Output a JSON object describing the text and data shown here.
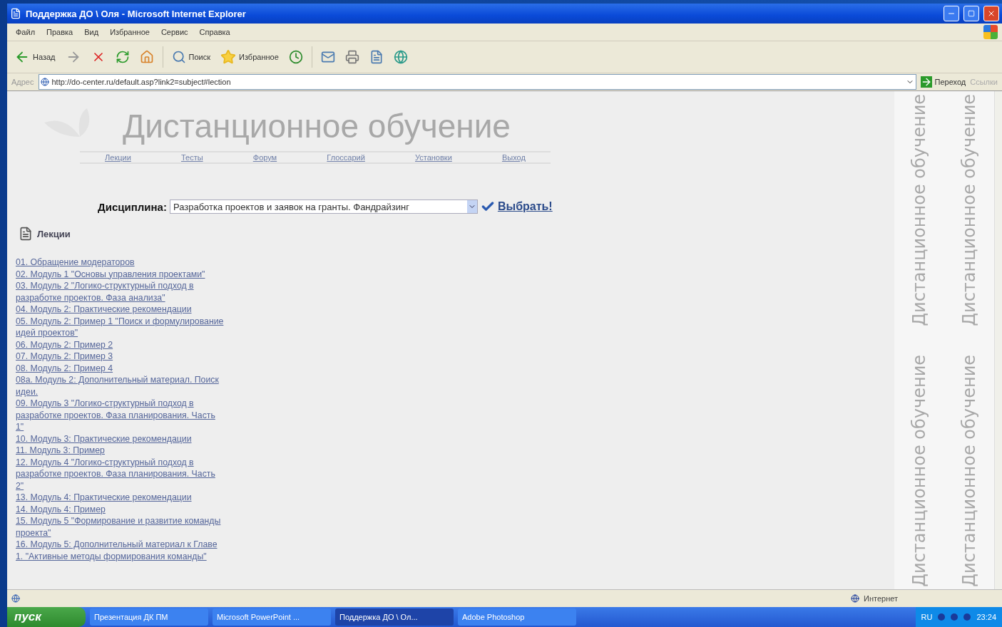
{
  "window": {
    "title": "Поддержка ДО \\ Оля - Microsoft Internet Explorer"
  },
  "menu": [
    "Файл",
    "Правка",
    "Вид",
    "Избранное",
    "Сервис",
    "Справка"
  ],
  "toolbar": {
    "back": "Назад",
    "search": "Поиск",
    "favorites": "Избранное"
  },
  "address": {
    "label": "Адрес",
    "value": "http://do-center.ru/default.asp?link2=subject#lection",
    "go": "Переход",
    "links": "Ссылки"
  },
  "page": {
    "logo": "Дистанционное обучение",
    "nav": [
      "Лекции",
      "Тесты",
      "Форум",
      "Глоссарий",
      "Установки",
      "Выход"
    ],
    "discipline_label": "Дисциплина:",
    "discipline_value": "Разработка проектов и заявок на гранты. Фандрайзинг",
    "select_button": "Выбрать!",
    "section_title": "Лекции",
    "lectures": [
      "01. Обращение модераторов",
      "02. Модуль 1 \"Основы управления проектами\"",
      "03. Модуль 2 \"Логико-структурный подход в разработке проектов. Фаза анализа\"",
      "04. Модуль 2: Практические рекомендации",
      "05. Модуль 2: Пример 1 \"Поиск и формулирование идей проектов\"",
      "06. Модуль 2: Пример 2",
      "07. Модуль 2: Пример 3",
      "08. Модуль 2: Пример 4",
      "08а. Модуль 2: Дополнительный материал. Поиск идеи.",
      "09. Модуль 3 \"Логико-структурный подход в разработке проектов. Фаза планирования. Часть 1\"",
      "10. Модуль 3: Практические рекомендации",
      "11. Модуль 3: Пример",
      "12. Модуль 4 \"Логико-структурный подход в разработке проектов. Фаза планирования. Часть 2\"",
      "13. Модуль 4: Практические рекомендации",
      "14. Модуль 4: Пример",
      "15. Модуль 5 \"Формирование и развитие команды проекта\"",
      "16. Модуль 5: Дополнительный материал к Главе 1. \"Активные методы формирования команды\""
    ],
    "side_banner": [
      "Дистанционное обучение",
      "Дистанционное обучение",
      "Дистанционное обучение",
      "Дистанционное обучение"
    ]
  },
  "status_bar": {
    "zone": "Интернет"
  },
  "taskbar": {
    "start": "пуск",
    "tasks": [
      {
        "label": "Презентация ДК ПМ",
        "selected": false
      },
      {
        "label": "Microsoft PowerPoint ...",
        "selected": false
      },
      {
        "label": "Поддержка ДО \\ Ол...",
        "selected": true
      },
      {
        "label": "Adobe Photoshop",
        "selected": false
      }
    ],
    "lang": "RU",
    "clock": "23:24"
  }
}
